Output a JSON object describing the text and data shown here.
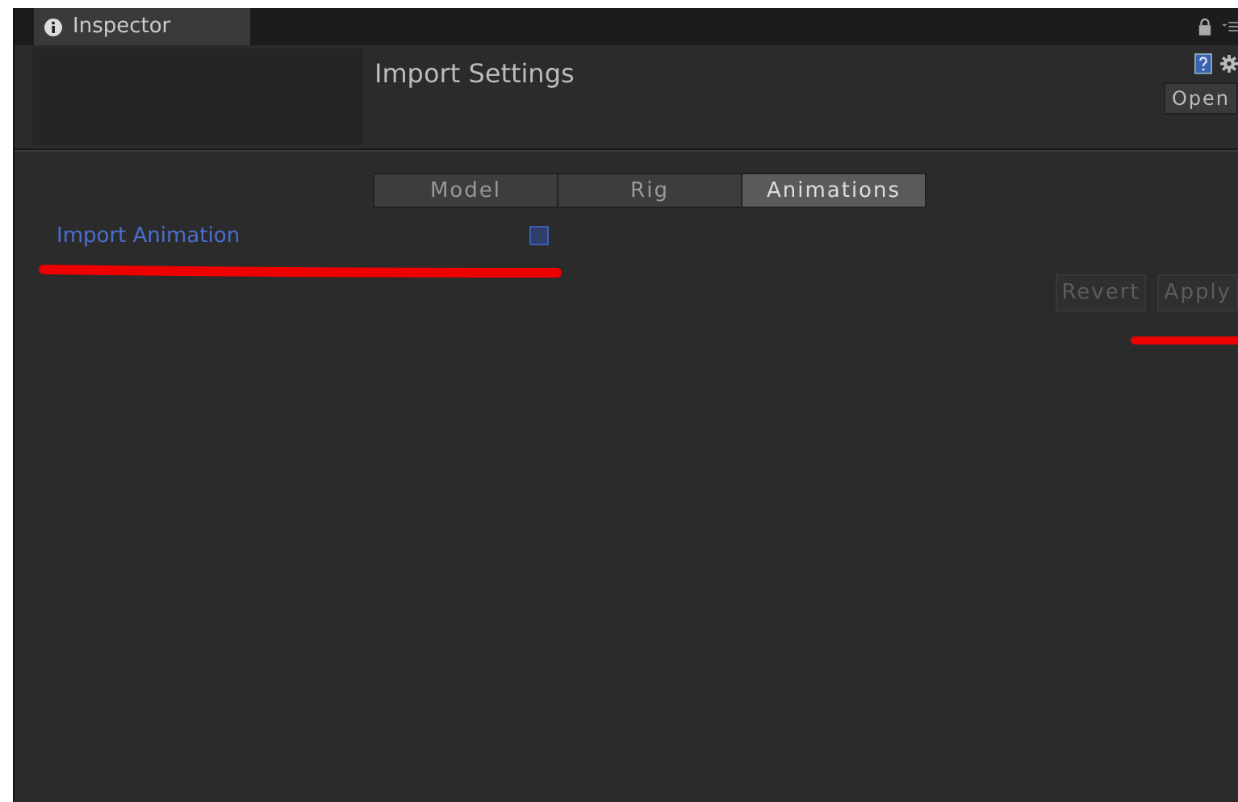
{
  "window": {
    "tab_title": "Inspector",
    "lock": true
  },
  "header": {
    "title": "Import Settings",
    "open_button": "Open"
  },
  "tabs": [
    {
      "label": "Model",
      "selected": false
    },
    {
      "label": "Rig",
      "selected": false
    },
    {
      "label": "Animations",
      "selected": true
    }
  ],
  "options": [
    {
      "label": "Import Animation",
      "checked": false
    }
  ],
  "buttons": [
    {
      "label": "Revert",
      "disabled": true
    },
    {
      "label": "Apply",
      "disabled": true
    }
  ]
}
